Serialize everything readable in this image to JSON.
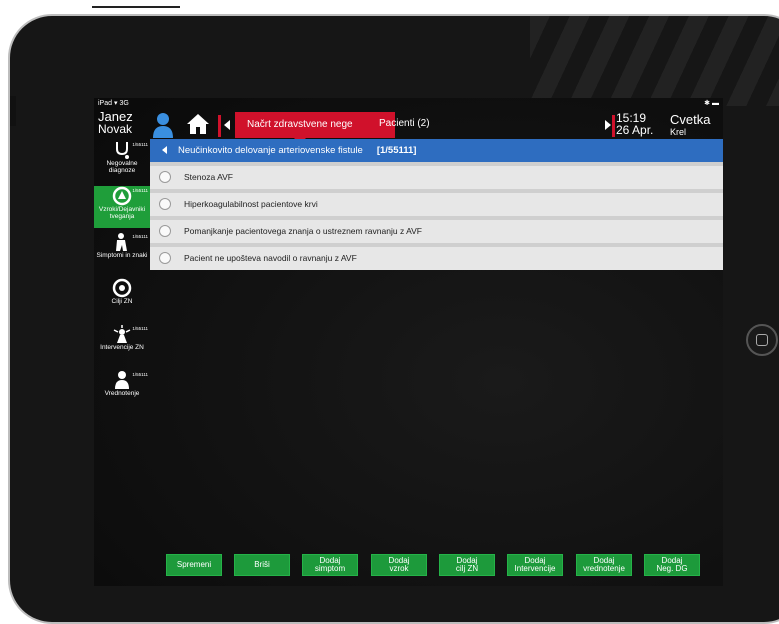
{
  "status": {
    "carrier": "iPad",
    "network": "3G"
  },
  "user": {
    "first_name": "Janez",
    "last_name": "Novak"
  },
  "header": {
    "active_tab": "Načrt zdravstvene nege",
    "patients_label": "Pacienti (2)",
    "time": "15:19",
    "date": "26 Apr."
  },
  "nurse": {
    "first_name": "Cvetka",
    "last_name": "Krel"
  },
  "sidebar": {
    "items": [
      {
        "label": "Negovalne diagnoze",
        "count": "1/55111",
        "icon": "stethoscope-icon",
        "active": false
      },
      {
        "label": "Vzroki/Dejavniki tveganja",
        "count": "1/55111",
        "icon": "warning-circle-icon",
        "active": true
      },
      {
        "label": "Simptomi in znaki",
        "count": "1/55111",
        "icon": "patient-icon",
        "active": false
      },
      {
        "label": "Cilji ZN",
        "count": "",
        "icon": "target-icon",
        "active": false
      },
      {
        "label": "Intervencije ZN",
        "count": "1/55111",
        "icon": "nurse-icon",
        "active": false
      },
      {
        "label": "Vrednotenje",
        "count": "1/55111",
        "icon": "person-check-icon",
        "active": false
      }
    ]
  },
  "panel": {
    "title": "Neučinkovito delovanje arteriovenske fistule",
    "code": "[1/55111]",
    "options": [
      "Stenoza AVF",
      "Hiperkoagulabilnost pacientove krvi",
      "Pomanjkanje pacientovega znanja o ustreznem ravnanju z AVF",
      "Pacient ne upošteva navodil o ravnanju z AVF"
    ]
  },
  "buttons": [
    {
      "line1": "Spremeni",
      "line2": ""
    },
    {
      "line1": "Briši",
      "line2": ""
    },
    {
      "line1": "Dodaj",
      "line2": "simptom"
    },
    {
      "line1": "Dodaj",
      "line2": "vzrok"
    },
    {
      "line1": "Dodaj",
      "line2": "cilj ZN"
    },
    {
      "line1": "Dodaj",
      "line2": "Intervencije"
    },
    {
      "line1": "Dodaj",
      "line2": "vrednotenje"
    },
    {
      "line1": "Dodaj",
      "line2": "Neg. DG"
    }
  ],
  "colors": {
    "accent_red": "#d0112b",
    "active_green": "#1f9e3a",
    "header_blue": "#2e6dc0"
  }
}
